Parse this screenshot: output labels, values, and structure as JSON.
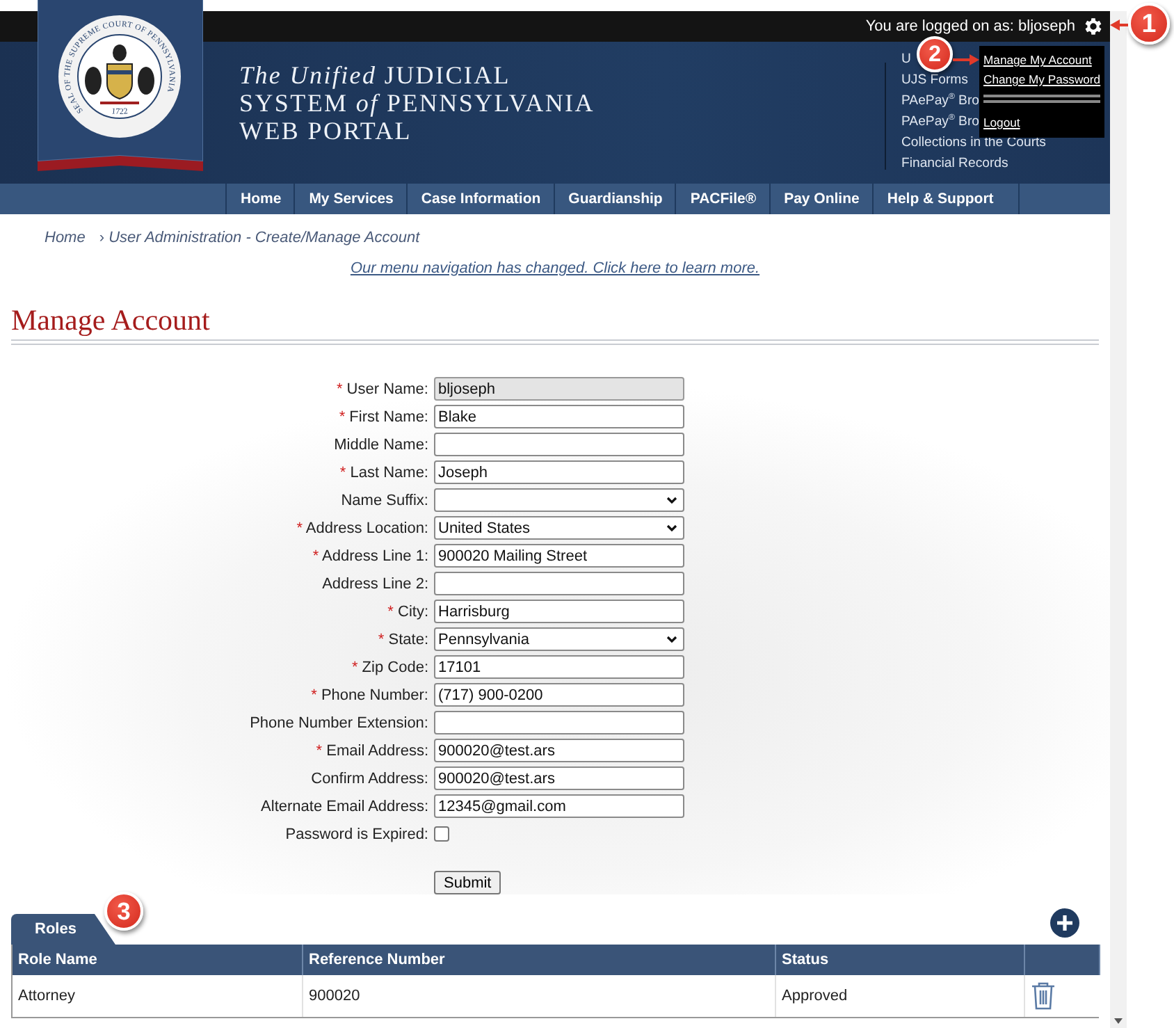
{
  "top_bar": {
    "login_text": "You are logged on as: bljoseph"
  },
  "seal": {
    "ring_text": "SEAL OF THE SUPREME COURT OF PENNSYLVANIA",
    "year": "1722"
  },
  "site_title": {
    "lines": [
      "*The Unified* JUDICIAL",
      "SYSTEM *of* PENNSYLVANIA",
      "WEB PORTAL"
    ]
  },
  "quick_links": [
    {
      "label": "U"
    },
    {
      "label": "UJS Forms"
    },
    {
      "label": "PAePay$^{®}$ Bro"
    },
    {
      "label": "PAePay$^{®}$ Bro"
    },
    {
      "label": "Collections in the Courts"
    },
    {
      "label": "Financial Records"
    }
  ],
  "user_menu": {
    "items": [
      {
        "kind": "link",
        "label": "Manage My Account"
      },
      {
        "kind": "link",
        "label": "Change My Password"
      },
      {
        "kind": "separator"
      },
      {
        "kind": "link",
        "label": "Logout"
      }
    ]
  },
  "nav": [
    {
      "label": "Home"
    },
    {
      "label": "My Services"
    },
    {
      "label": "Case Information"
    },
    {
      "label": "Guardianship"
    },
    {
      "label": "PACFile®"
    },
    {
      "label": "Pay Online"
    },
    {
      "label": "Help & Support"
    }
  ],
  "breadcrumb": {
    "items": [
      "Home",
      "User Administration - Create/Manage Account"
    ],
    "separator": "›"
  },
  "notice_link": "Our menu navigation has changed. Click here to learn more.",
  "page_title": "Manage Account",
  "form": {
    "fields": [
      {
        "label": "User Name:",
        "required_mark": "*",
        "kind": "text",
        "value": "bljoseph",
        "disabled": true
      },
      {
        "label": "First Name:",
        "required_mark": "*",
        "kind": "text",
        "value": "Blake",
        "disabled": false
      },
      {
        "label": "Middle Name:",
        "kind": "text",
        "disabled": false
      },
      {
        "label": "Last Name:",
        "required_mark": "*",
        "kind": "text",
        "value": "Joseph",
        "disabled": false
      },
      {
        "label": "Name Suffix:",
        "kind": "select"
      },
      {
        "label": "Address Location:",
        "required_mark": "*",
        "kind": "select",
        "value": "United States"
      },
      {
        "label": "Address Line 1:",
        "required_mark": "*",
        "kind": "text",
        "value": "900020 Mailing Street",
        "disabled": false
      },
      {
        "label": "Address Line 2:",
        "kind": "text",
        "disabled": false
      },
      {
        "label": "City:",
        "required_mark": "*",
        "kind": "text",
        "value": "Harrisburg",
        "disabled": false
      },
      {
        "label": "State:",
        "required_mark": "*",
        "kind": "select",
        "value": "Pennsylvania"
      },
      {
        "label": "Zip Code:",
        "required_mark": "*",
        "kind": "text",
        "value": "17101",
        "disabled": false
      },
      {
        "label": "Phone Number:",
        "required_mark": "*",
        "kind": "text",
        "value": "(717) 900-0200",
        "disabled": false
      },
      {
        "label": "Phone Number Extension:",
        "kind": "text",
        "disabled": false
      },
      {
        "label": "Email Address:",
        "required_mark": "*",
        "kind": "text",
        "value": "900020@test.ars",
        "disabled": false
      },
      {
        "label": "Confirm Address:",
        "kind": "text",
        "value": "900020@test.ars",
        "disabled": false
      },
      {
        "label": "Alternate Email Address:",
        "kind": "text",
        "value": "12345@gmail.com",
        "disabled": false
      },
      {
        "label": "Password is Expired:",
        "kind": "checkbox",
        "checked": false
      }
    ],
    "submit": "Submit"
  },
  "roles": {
    "tab": "Roles",
    "columns": [
      "Role Name",
      "Reference Number",
      "Status"
    ],
    "rows": [
      [
        "Attorney",
        "900020",
        "Approved"
      ]
    ]
  },
  "callouts": [
    "1",
    "2",
    "3"
  ]
}
